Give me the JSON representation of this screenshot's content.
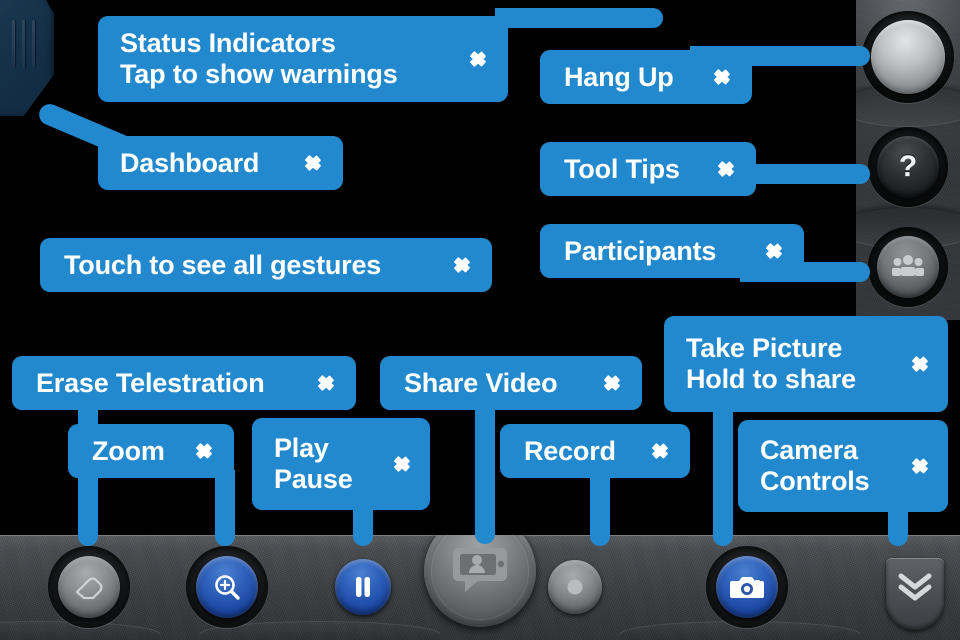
{
  "app": {
    "title": "Video Call Coach Marks",
    "accent_blue": "#2389ce",
    "background": "#000000"
  },
  "callouts": [
    {
      "id": "status-indicators",
      "lines": [
        "Status Indicators",
        "Tap to show warnings"
      ],
      "chevron": "chevron-right-icon"
    },
    {
      "id": "dashboard",
      "lines": [
        "Dashboard"
      ],
      "chevron": "chevron-right-icon"
    },
    {
      "id": "gestures",
      "lines": [
        "Touch to see all gestures"
      ],
      "chevron": "chevron-right-icon"
    },
    {
      "id": "hang-up",
      "lines": [
        "Hang Up"
      ],
      "chevron": "chevron-right-icon"
    },
    {
      "id": "tool-tips",
      "lines": [
        "Tool Tips"
      ],
      "chevron": "chevron-right-icon"
    },
    {
      "id": "participants",
      "lines": [
        "Participants"
      ],
      "chevron": "chevron-right-icon"
    },
    {
      "id": "erase-telestration",
      "lines": [
        "Erase Telestration"
      ],
      "chevron": "chevron-right-icon"
    },
    {
      "id": "share-video",
      "lines": [
        "Share Video"
      ],
      "chevron": "chevron-right-icon"
    },
    {
      "id": "take-picture",
      "lines": [
        "Take Picture",
        "Hold to share"
      ],
      "chevron": "chevron-right-icon"
    },
    {
      "id": "zoom",
      "lines": [
        "Zoom"
      ],
      "chevron": "chevron-right-icon"
    },
    {
      "id": "play-pause",
      "lines": [
        "Play",
        "Pause"
      ],
      "chevron": "chevron-right-icon"
    },
    {
      "id": "record",
      "lines": [
        "Record"
      ],
      "chevron": "chevron-right-icon"
    },
    {
      "id": "camera-controls",
      "lines": [
        "Camera",
        "Controls"
      ],
      "chevron": "chevron-right-icon"
    }
  ],
  "side_panel": {
    "buttons": [
      {
        "id": "hang-up",
        "icon": "hang-up-button-icon",
        "glyph": ""
      },
      {
        "id": "tool-tips",
        "icon": "question-mark-icon",
        "glyph": "?"
      },
      {
        "id": "participants",
        "icon": "people-group-icon",
        "glyph": ""
      }
    ]
  },
  "toolbar": {
    "buttons": [
      {
        "id": "erase",
        "icon": "eraser-icon"
      },
      {
        "id": "zoom",
        "icon": "magnifier-plus-icon"
      },
      {
        "id": "play-pause",
        "icon": "pause-icon"
      },
      {
        "id": "share-video",
        "icon": "video-share-icon"
      },
      {
        "id": "record",
        "icon": "record-dot-icon"
      },
      {
        "id": "camera",
        "icon": "camera-icon"
      },
      {
        "id": "collapse",
        "icon": "double-chevron-down-icon"
      }
    ]
  },
  "tab_handle": {
    "id": "dashboard-tab-handle",
    "icon": "grip-lines-icon"
  }
}
